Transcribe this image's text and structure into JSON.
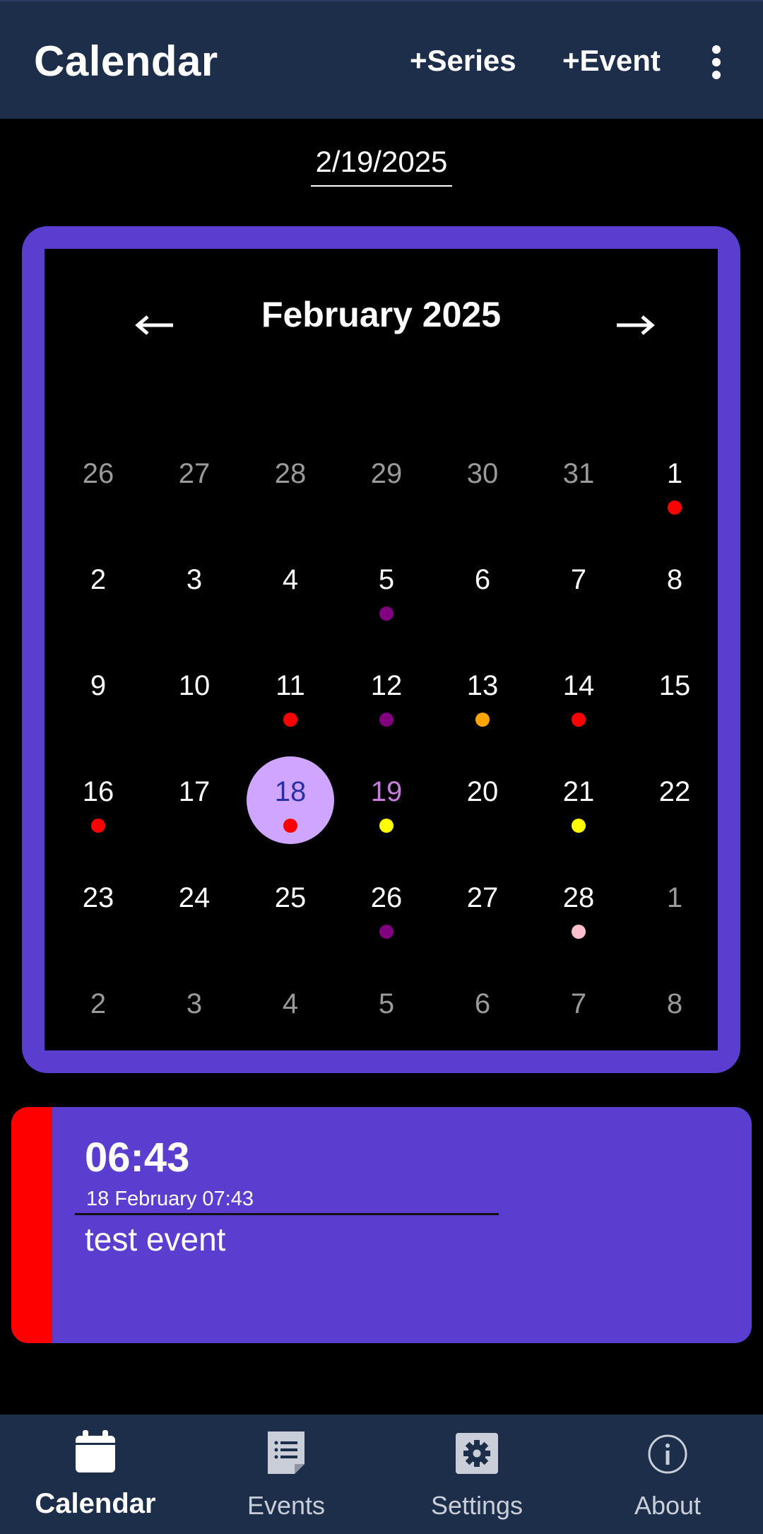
{
  "appbar": {
    "title": "Calendar",
    "series_label": "+Series",
    "event_label": "+Event"
  },
  "date_field": {
    "value": "2/19/2025"
  },
  "calendar": {
    "month_label": "February 2025",
    "weeks": [
      [
        {
          "d": "26",
          "out": true
        },
        {
          "d": "27",
          "out": true
        },
        {
          "d": "28",
          "out": true
        },
        {
          "d": "29",
          "out": true
        },
        {
          "d": "30",
          "out": true
        },
        {
          "d": "31",
          "out": true
        },
        {
          "d": "1",
          "dot": "#ff0000"
        }
      ],
      [
        {
          "d": "2"
        },
        {
          "d": "3"
        },
        {
          "d": "4"
        },
        {
          "d": "5",
          "dot": "#800080"
        },
        {
          "d": "6"
        },
        {
          "d": "7"
        },
        {
          "d": "8"
        }
      ],
      [
        {
          "d": "9"
        },
        {
          "d": "10"
        },
        {
          "d": "11",
          "dot": "#ff0000"
        },
        {
          "d": "12",
          "dot": "#800080"
        },
        {
          "d": "13",
          "dot": "#ffa500"
        },
        {
          "d": "14",
          "dot": "#ff0000"
        },
        {
          "d": "15"
        }
      ],
      [
        {
          "d": "16",
          "dot": "#ff0000"
        },
        {
          "d": "17"
        },
        {
          "d": "18",
          "selected": true,
          "dot": "#ff0000"
        },
        {
          "d": "19",
          "highlight": true,
          "dot": "#ffff00"
        },
        {
          "d": "20"
        },
        {
          "d": "21",
          "dot": "#ffff00"
        },
        {
          "d": "22"
        }
      ],
      [
        {
          "d": "23"
        },
        {
          "d": "24"
        },
        {
          "d": "25"
        },
        {
          "d": "26",
          "dot": "#800080"
        },
        {
          "d": "27"
        },
        {
          "d": "28",
          "dot": "#ffc0cb"
        },
        {
          "d": "1",
          "out": true
        }
      ],
      [
        {
          "d": "2",
          "out": true
        },
        {
          "d": "3",
          "out": true
        },
        {
          "d": "4",
          "out": true
        },
        {
          "d": "5",
          "out": true
        },
        {
          "d": "6",
          "out": true
        },
        {
          "d": "7",
          "out": true
        },
        {
          "d": "8",
          "out": true
        }
      ]
    ]
  },
  "event": {
    "time": "06:43",
    "subtitle": "18 February 07:43",
    "name": "test event",
    "stripe_color": "#ff0000"
  },
  "bottom_nav": {
    "items": [
      {
        "label": "Calendar",
        "icon": "calendar-icon",
        "active": true
      },
      {
        "label": "Events",
        "icon": "events-icon",
        "active": false
      },
      {
        "label": "Settings",
        "icon": "settings-icon",
        "active": false
      },
      {
        "label": "About",
        "icon": "about-icon",
        "active": false
      }
    ]
  },
  "colors": {
    "appbar_bg": "#1d2e4a",
    "accent": "#5b3ecf",
    "selected_day_bg": "#cfa6ff"
  }
}
